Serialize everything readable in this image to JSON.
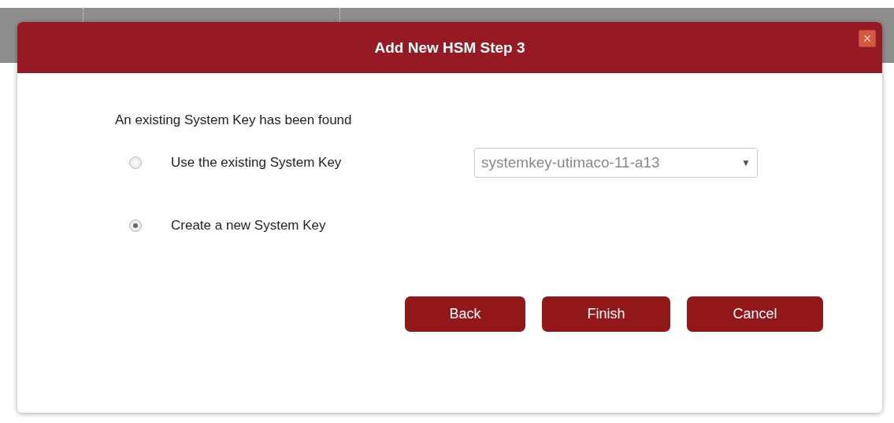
{
  "dialog": {
    "title": "Add New HSM Step 3",
    "close": "×"
  },
  "message": "An existing System Key has been found",
  "options": [
    {
      "label": "Use the existing System Key",
      "selected": false,
      "dropdown": {
        "value": "systemkey-utimaco-11-a13",
        "caret": "▼"
      }
    },
    {
      "label": "Create a new System Key",
      "selected": true
    }
  ],
  "buttons": [
    "Back",
    "Finish",
    "Cancel"
  ]
}
